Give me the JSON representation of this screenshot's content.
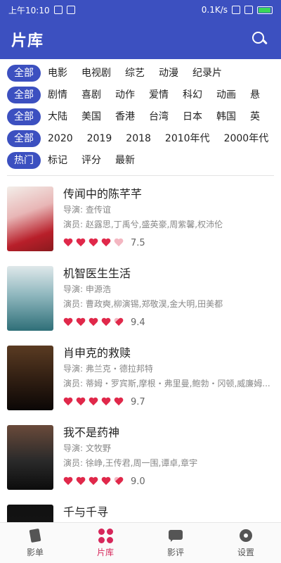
{
  "status_bar": {
    "time": "上午10:10",
    "net_speed": "0.1K/s",
    "battery": "85"
  },
  "app": {
    "title": "片库"
  },
  "filters": {
    "type": [
      "全部",
      "电影",
      "电视剧",
      "综艺",
      "动漫",
      "纪录片"
    ],
    "genre": [
      "全部",
      "剧情",
      "喜剧",
      "动作",
      "爱情",
      "科幻",
      "动画",
      "悬"
    ],
    "region": [
      "全部",
      "大陆",
      "美国",
      "香港",
      "台湾",
      "日本",
      "韩国",
      "英"
    ],
    "year": [
      "全部",
      "2020",
      "2019",
      "2018",
      "2010年代",
      "2000年代"
    ],
    "sort": [
      "热门",
      "标记",
      "评分",
      "最新"
    ]
  },
  "labels": {
    "director": "导演: ",
    "cast": "演员: "
  },
  "movies": [
    {
      "title": "传闻中的陈芊芊",
      "director": "查传谊",
      "cast": "赵露思,丁禹兮,盛英豪,周紫馨,权沛伦",
      "hearts": [
        1,
        1,
        1,
        1,
        0
      ],
      "score": "7.5"
    },
    {
      "title": "机智医生生活",
      "director": "申源浩",
      "cast": "曹政奭,柳演锡,郑敬淏,金大明,田美都",
      "hearts": [
        1,
        1,
        1,
        1,
        0.5
      ],
      "score": "9.4"
    },
    {
      "title": "肖申克的救赎",
      "director": "弗兰克・德拉邦特",
      "cast": "蒂姆・罗宾斯,摩根・弗里曼,鲍勃・冈顿,威廉姆...",
      "hearts": [
        1,
        1,
        1,
        1,
        1
      ],
      "score": "9.7"
    },
    {
      "title": "我不是药神",
      "director": "文牧野",
      "cast": "徐峥,王传君,周一围,谭卓,章宇",
      "hearts": [
        1,
        1,
        1,
        1,
        0.5
      ],
      "score": "9.0"
    },
    {
      "title": "千与千寻",
      "director": "",
      "cast": "",
      "hearts": [],
      "score": ""
    }
  ],
  "bottom_nav": [
    {
      "label": "影单",
      "icon": "film-icon"
    },
    {
      "label": "片库",
      "icon": "grid-icon"
    },
    {
      "label": "影评",
      "icon": "chat-icon"
    },
    {
      "label": "设置",
      "icon": "gear-icon"
    }
  ],
  "colors": {
    "primary": "#3c50c0",
    "accent": "#d6265a",
    "heart": "#e0284a"
  }
}
